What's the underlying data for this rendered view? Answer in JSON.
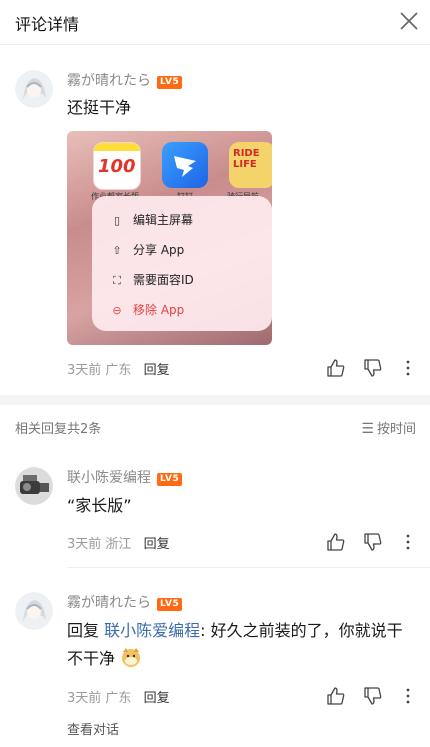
{
  "header": {
    "title": "评论详情",
    "close_icon": "close-icon"
  },
  "main_comment": {
    "user": "霧が晴れたら",
    "level": "LV5",
    "text": "还挺干净",
    "screenshot": {
      "apps": [
        "作业帮家长版",
        "钉钉",
        "骑行导航"
      ],
      "app_icon_text": [
        "100",
        "",
        "RIDE LIFE"
      ],
      "menu": [
        {
          "icon": "phone-icon",
          "label": "编辑主屏幕"
        },
        {
          "icon": "share-icon",
          "label": "分享 App"
        },
        {
          "icon": "faceid-icon",
          "label": "需要面容ID"
        },
        {
          "icon": "remove-icon",
          "label": "移除 App"
        }
      ]
    },
    "time": "3天前",
    "location": "广东",
    "reply_label": "回复"
  },
  "related": {
    "title": "相关回复共2条",
    "sort_label": "按时间"
  },
  "replies": [
    {
      "user": "联小陈爱编程",
      "level": "LV5",
      "text": "“家长版”",
      "time": "3天前",
      "location": "浙江",
      "reply_label": "回复"
    },
    {
      "user": "霧が晴れたら",
      "level": "LV5",
      "prefix": "回复 ",
      "at": "联小陈爱编程",
      "text": ": 好久之前装的了，你就说干不干净",
      "time": "3天前",
      "location": "广东",
      "reply_label": "回复",
      "view_conv": "查看对话"
    }
  ]
}
